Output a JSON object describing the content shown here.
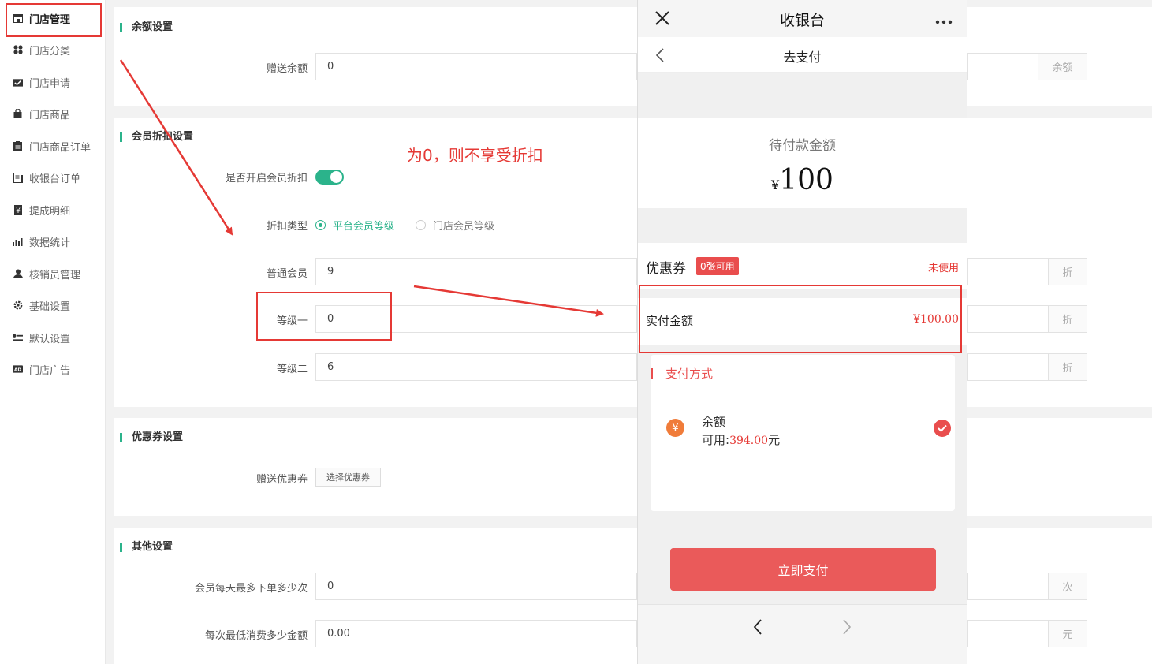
{
  "sidebar": {
    "items": [
      {
        "label": "门店管理",
        "icon": "store-icon"
      },
      {
        "label": "门店分类",
        "icon": "category-icon"
      },
      {
        "label": "门店申请",
        "icon": "apply-icon"
      },
      {
        "label": "门店商品",
        "icon": "product-icon"
      },
      {
        "label": "门店商品订单",
        "icon": "order-icon"
      },
      {
        "label": "收银台订单",
        "icon": "cashier-order-icon"
      },
      {
        "label": "提成明细",
        "icon": "commission-icon"
      },
      {
        "label": "数据统计",
        "icon": "chart-icon"
      },
      {
        "label": "核销员管理",
        "icon": "user-icon"
      },
      {
        "label": "基础设置",
        "icon": "gear-icon"
      },
      {
        "label": "默认设置",
        "icon": "toggle-list-icon"
      },
      {
        "label": "门店广告",
        "icon": "ad-icon"
      }
    ]
  },
  "balance": {
    "title": "余额设置",
    "gift_label": "赠送余额",
    "gift_value": "0",
    "suffix": "余额"
  },
  "discount": {
    "title": "会员折扣设置",
    "enable_label": "是否开启会员折扣",
    "enabled": true,
    "type_label": "折扣类型",
    "type_options": [
      "平台会员等级",
      "门店会员等级"
    ],
    "selected": "平台会员等级",
    "levels": [
      {
        "label": "普通会员",
        "value": "9"
      },
      {
        "label": "等级一",
        "value": "0"
      },
      {
        "label": "等级二",
        "value": "6"
      }
    ],
    "suffix": "折"
  },
  "annotation": "为0，则不享受折扣",
  "coupon": {
    "title": "优惠券设置",
    "gift_label": "赠送优惠券",
    "button": "选择优惠券"
  },
  "other": {
    "title": "其他设置",
    "max_orders_label": "会员每天最多下单多少次",
    "max_orders_value": "0",
    "max_orders_suffix": "次",
    "min_amount_label": "每次最低消费多少金额",
    "min_amount_value": "0.00",
    "min_amount_suffix": "元"
  },
  "phone": {
    "title": "收银台",
    "subtitle": "去支付",
    "pending_label": "待付款金额",
    "pending_currency": "¥",
    "pending_amount": "100",
    "coupon_label": "优惠券",
    "coupon_badge": "0张可用",
    "coupon_status": "未使用",
    "paid_label": "实付金额",
    "paid_amount": "¥100.00",
    "pay_method_title": "支付方式",
    "method_name": "余额",
    "method_avail_prefix": "可用:",
    "method_avail_amount": "394.00",
    "method_avail_unit": "元",
    "pay_button": "立即支付"
  },
  "colors": {
    "accent": "#2bb38b",
    "red": "#e53935",
    "pay_button": "#ea5a5a"
  }
}
